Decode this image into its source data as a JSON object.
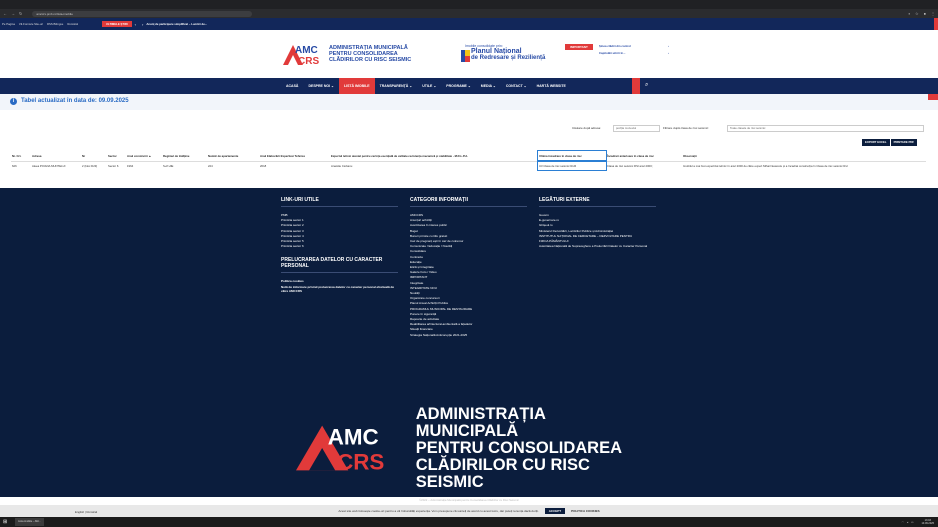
{
  "browser": {
    "url": "amccrs.pmb.ro/lista-imobile",
    "nav_back": "←",
    "nav_forward": "→",
    "nav_reload": "↻"
  },
  "topbar": {
    "links": [
      "Pe Pagina",
      "Vă Formule Site-uri",
      "RSS Bilingve",
      "Română"
    ],
    "ultime": "ULTIMELE ȘTIRI",
    "news": "Anunț de participare simplificat – Lucrări de..."
  },
  "header": {
    "logo_top": "AMC",
    "logo_bottom": "CRS",
    "logo_text": [
      "Administrația Municipală",
      "pentru Consolidarea",
      "Clădirilor cu Risc Seismic"
    ],
    "pnrr_line1": "Imobile consolidate prin:",
    "pnrr_line2": "Planul Național",
    "pnrr_line3": "de Redresare și Reziliență",
    "important_label": "IMPORTANT",
    "important_items": [
      "Șinoa clădiri din control",
      "Capitolări uitrrii în..."
    ]
  },
  "nav": {
    "items": [
      "Acasă",
      "Despre noi ⌄",
      "Listă imobile",
      "Transparență ⌄",
      "Utile ⌄",
      "Programe ⌄",
      "Media ⌄",
      "Contact ⌄",
      "Hartă website"
    ],
    "active_index": 2
  },
  "notice": {
    "icon": "i",
    "text": "Tabel actualizat în data de: 09.09.2025"
  },
  "filters": {
    "search_label": "Căutare după adresa:",
    "search_placeholder": "poziția muzeului",
    "class_label": "Filtrare după clasa de risc seismic:",
    "class_value": "Toate clasele de risc seismic"
  },
  "export": {
    "excel": "EXPORT EXCEL",
    "pdf": "PRINTARE PDF"
  },
  "table": {
    "headers": [
      "Nr. Crt.",
      "Adresa",
      "Nr",
      "Sector",
      "Anul construirii ▲",
      "Regimul de înălțime",
      "Număr de apartamente",
      "Anul Elaborării Expertizei Tehnice",
      "Expertul tehnic atestat pentru cerința esențială de calitate-rezistența mecanică și stabilitate - M.D.L.P.A.",
      "Ultima încadrare în clasa de risc",
      "Încadrari anterioare în clasa de risc",
      "Observații"
    ],
    "rows": [
      [
        "626",
        "Aleea POIANA MUNTELUI",
        "2 (bloc D23)",
        "Sector 6",
        "1964",
        "S+P+9E",
        "224",
        "2018",
        "Anatolie Ciobanu",
        "U3 Clasa de risc seismic RsIII",
        "Clasa de risc seismic RSI anul 2000;",
        "Imobilul a mai fost expertizat tehnic în anul 2000 de către expert Mihai Neascoiu și a încadrat construcția în Clasa de risc seismic RsI"
      ]
    ]
  },
  "footer": {
    "col1_title": "Link-uri utile",
    "col1_links": [
      "PMB",
      "Primăria sector 1",
      "Primăria sector 2",
      "Primăria sector 3",
      "Primăria sector 4",
      "Primăria sector 5",
      "Primăria sector 6"
    ],
    "col1b_title": "Prelucrarea datelor cu caracter personal",
    "col1b_links": [
      "Politica cookies",
      "Notă de informare privind prelucrarea datelor cu caracter personal efectuată de către AMCCRS"
    ],
    "col2_title": "Categorii informații",
    "col2_links": [
      "AMCCRS",
      "Anunțuri achiziții",
      "Avertizarea în interes public",
      "Buget",
      "Bunuri primite cu titlu gratuit",
      "Caz de pregnanț ești în caz de cutremur",
      "Comunicate / Educație / Noutăți",
      "Consolidare",
      "Contracte",
      "Educație",
      "Etică și Integritate",
      "Galerie Foto / Video",
      "IMPORTANT",
      "Integritate",
      "INTEGRITATE NOU",
      "Noutăți",
      "Organizare concursuri",
      "Planul Anual Achiziții Publice",
      "PROGRAMUL MUNICIPAL DE RESTAURARE",
      "Punere în siguranță",
      "Rapoarte de activitate",
      "Reabilitarea arhitectural-ambientală a fațadelor",
      "Situații financiare",
      "Strategia Națională Anticorupție 2021-2025"
    ],
    "col3_title": "Legături externe",
    "col3_links": [
      "Guvern",
      "E-guvernare.ro",
      "Ghișeul.ro",
      "Ministerul Dezvoltării, Lucrărilor Publice și Administrației",
      "INSTITUTUL NAȚIONAL DE CERCETARE – DEZVOLTARE PENTRU",
      "FIZICA PĂMÂNTULUI",
      "Autoritatea Națională de Supraveghere a Prelucrării Datelor cu Caracter Personal"
    ],
    "logo_top": "AMC",
    "logo_bottom": "CRS",
    "logo_text": [
      "Administrația Municipală",
      "pentru Consolidarea",
      "Clădirilor cu Risc Seismic"
    ],
    "copyright": "©2022 – Administrația Municipală pentru Consolidarea Clădirilor cu Risc Seismic"
  },
  "cookie": {
    "text": "Acest site web folosește cookie-uri pentru a vă îmbunătăți experiența. Vom presupune că sunteți de acord cu acest lucru, dar puteți renunța dacă doriți.",
    "accept": "ACCEPT",
    "policy": "POLITICA COOKIES"
  },
  "lang": "English | Română",
  "taskbar": {
    "start": "⊞",
    "app": "Lista imobile – AM...",
    "time": "13:03",
    "date": "10.09.2025"
  },
  "colors": {
    "navy": "#12275a",
    "red": "#e13a3a",
    "footer": "#0b1d3d",
    "blue": "#274aa5"
  }
}
